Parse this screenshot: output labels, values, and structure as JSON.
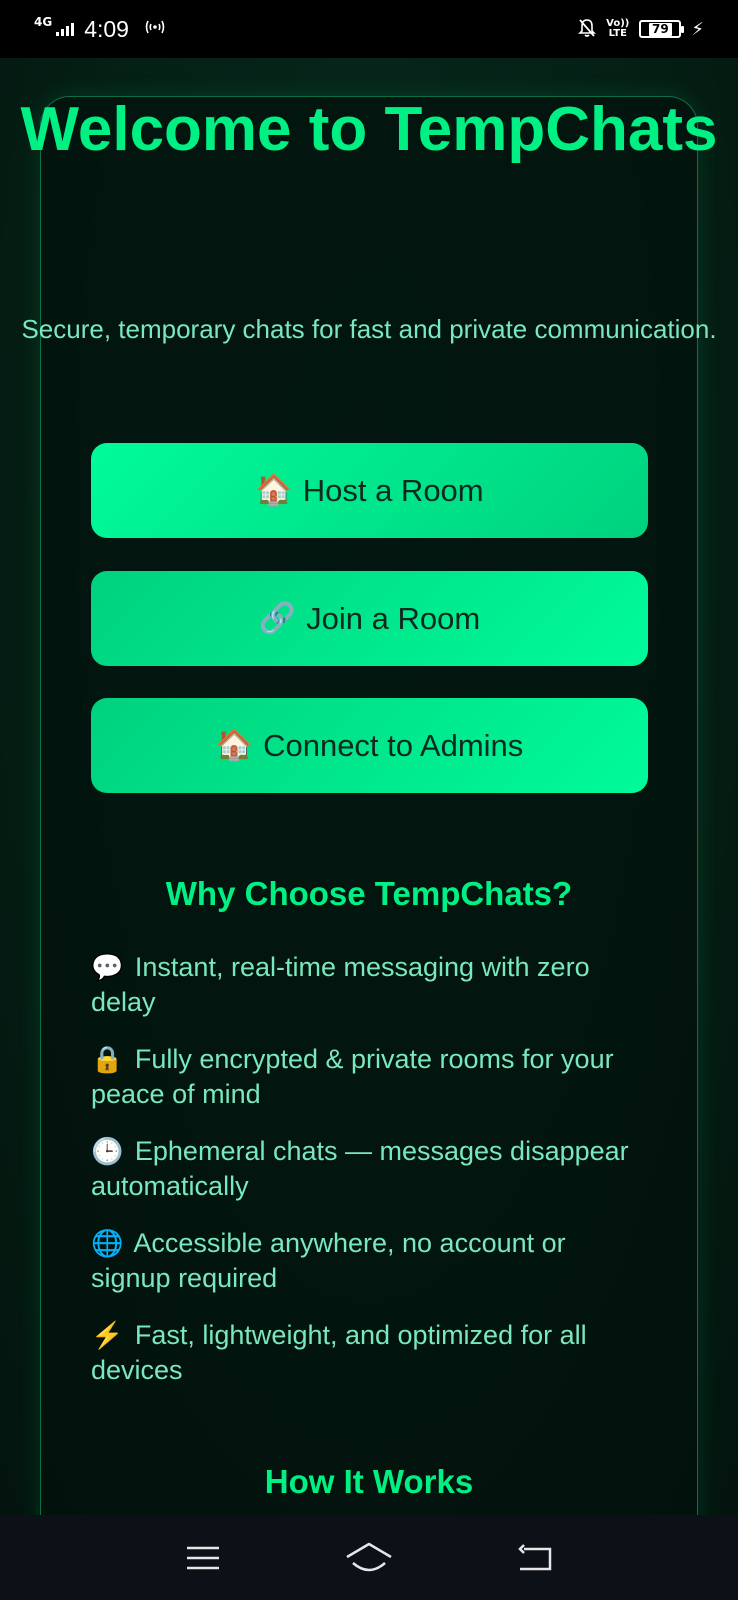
{
  "status_bar": {
    "network": "4G",
    "time": "4:09",
    "hotspot_icon": "hotspot-icon",
    "volte_top": "Vo))",
    "volte_bottom": "LTE",
    "battery": "79",
    "charging_icon": "⚡"
  },
  "hero": {
    "title": "Welcome to TempChats",
    "subtitle": "Secure, temporary chats for fast and private communication."
  },
  "actions": {
    "host": {
      "icon": "🏠",
      "label": "Host a Room"
    },
    "join": {
      "icon": "🔗",
      "label": "Join a Room"
    },
    "admin": {
      "icon": "🏠",
      "label": "Connect to Admins"
    }
  },
  "why": {
    "heading": "Why Choose TempChats?",
    "features": [
      {
        "icon": "💬",
        "text": "Instant, real-time messaging with zero delay"
      },
      {
        "icon": "🔒",
        "text": "Fully encrypted & private rooms for your peace of mind"
      },
      {
        "icon": "🕒",
        "text": "Ephemeral chats — messages disappear automatically"
      },
      {
        "icon": "🌐",
        "text": "Accessible anywhere, no account or signup required"
      },
      {
        "icon": "⚡",
        "text": "Fast, lightweight, and optimized for all devices"
      }
    ]
  },
  "how": {
    "heading": "How It Works"
  },
  "colors": {
    "accent": "#00f083",
    "text": "#7ae8bf",
    "background": "#041510",
    "button_light": "#00fb9a",
    "button_dark": "#00d27e"
  },
  "nav_icons": [
    "menu-icon",
    "home-icon",
    "back-icon"
  ]
}
